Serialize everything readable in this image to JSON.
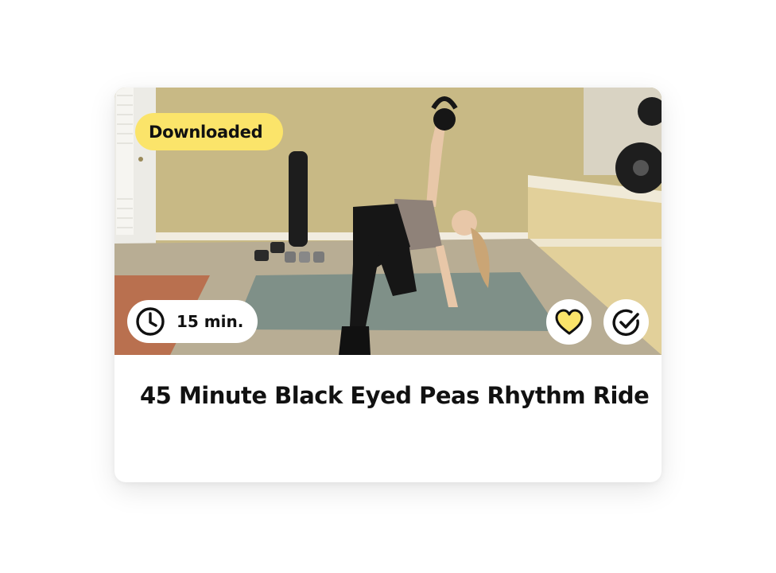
{
  "card": {
    "badge_label": "Downloaded",
    "duration_label": "15 min.",
    "title": "45 Minute Black Eyed Peas Rhythm Ride",
    "icons": {
      "duration": "clock-icon",
      "favorite": "heart-icon",
      "complete": "check-circle-icon"
    },
    "favorited": true
  },
  "colors": {
    "badge": "#fbe46a",
    "heart_fill": "#fbe46a",
    "text": "#111111"
  }
}
